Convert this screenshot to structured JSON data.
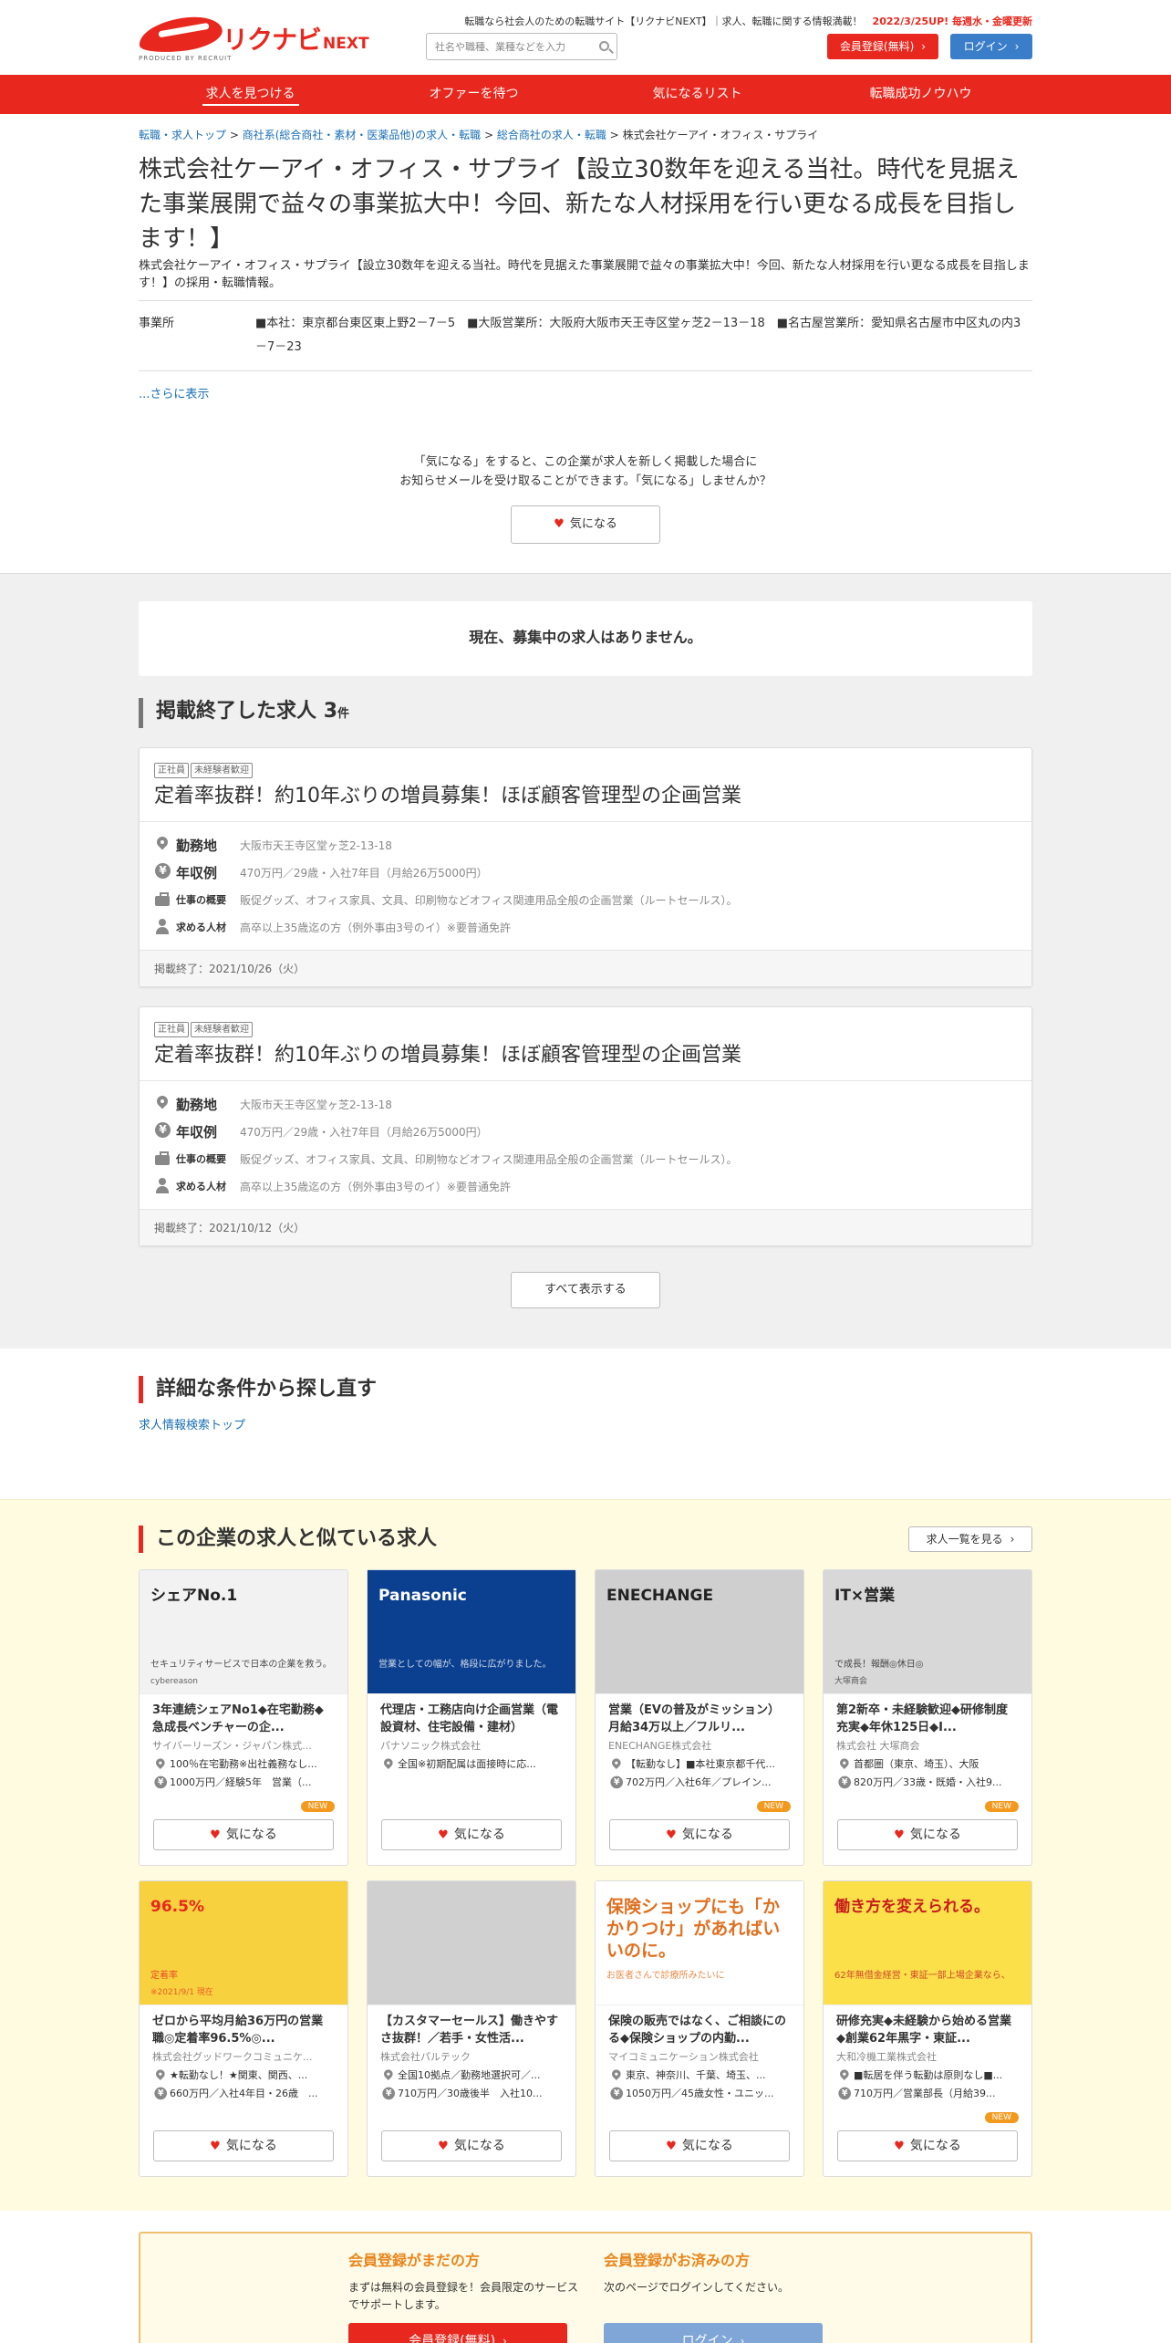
{
  "header": {
    "tagline_prefix": "転職なら社会人のための転職サイト【リクナビNEXT】｜求人、転職に関する情報満載！",
    "tagline_update": "2022/3/25UP! 毎週水・金曜更新",
    "brand_logo": "リクナビ",
    "brand_logo_sub": "NEXT",
    "produced_by": "PRODUCED BY RECRUIT",
    "search_placeholder": "社名や職種、業種などを入力",
    "register_label": "会員登録(無料)",
    "login_label": "ログイン",
    "accent_color": "#e8281e",
    "login_color": "#3a7dc9"
  },
  "nav": {
    "items": [
      {
        "label": "求人を見つける"
      },
      {
        "label": "オファーを待つ"
      },
      {
        "label": "気になるリスト"
      },
      {
        "label": "転職成功ノウハウ"
      }
    ]
  },
  "breadcrumb": {
    "items": [
      "転職・求人トップ",
      "商社系(総合商社・素材・医薬品他)の求人・転職",
      "総合商社の求人・転職"
    ],
    "current": "株式会社ケーアイ・オフィス・サプライ",
    "sep": ">"
  },
  "company": {
    "title": "株式会社ケーアイ・オフィス・サプライ【設立30数年を迎える当社。時代を見据えた事業展開で益々の事業拡大中！今回、新たな人材採用を行い更なる成長を目指します！】",
    "subtitle": "株式会社ケーアイ・オフィス・サプライ【設立30数年を迎える当社。時代を見据えた事業展開で益々の事業拡大中！今回、新たな人材採用を行い更なる成長を目指します！】の採用・転職情報。",
    "office_label": "事業所",
    "office_value": "■本社：東京都台東区東上野2－7－5　■大阪営業所：大阪府大阪市天王寺区堂ヶ芝2－13－18　■名古屋営業所：愛知県名古屋市中区丸の内3－7－23",
    "more_link": "...さらに表示",
    "kininaru_text_1": "「気になる」をすると、この企業が求人を新しく掲載した場合に",
    "kininaru_text_2": "お知らせメールを受け取ることができます。「気になる」しませんか？",
    "kininaru_button": "気になる"
  },
  "jobs": {
    "none_message": "現在、募集中の求人はありません。",
    "ended_heading": "掲載終了した求人",
    "ended_count": "3",
    "ended_unit": "件",
    "show_all": "すべて表示する",
    "items": [
      {
        "tags": [
          "正社員",
          "未経験者歓迎"
        ],
        "title": "定着率抜群！約10年ぶりの増員募集！ほぼ顧客管理型の企画営業",
        "location_label": "勤務地",
        "location": "大阪市天王寺区堂ヶ芝2-13-18",
        "salary_label": "年収例",
        "salary": "470万円／29歳・入社7年目（月給26万5000円）",
        "work_label": "仕事の概要",
        "work": "販促グッズ、オフィス家具、文具、印刷物などオフィス関連用品全般の企画営業（ルートセールス）。",
        "person_label": "求める人材",
        "person": "高卒以上35歳迄の方（例外事由3号のイ）※要普通免許",
        "end": "掲載終了：2021/10/26（火）"
      },
      {
        "tags": [
          "正社員",
          "未経験者歓迎"
        ],
        "title": "定着率抜群！約10年ぶりの増員募集！ほぼ顧客管理型の企画営業",
        "location_label": "勤務地",
        "location": "大阪市天王寺区堂ヶ芝2-13-18",
        "salary_label": "年収例",
        "salary": "470万円／29歳・入社7年目（月給26万5000円）",
        "work_label": "仕事の概要",
        "work": "販促グッズ、オフィス家具、文具、印刷物などオフィス関連用品全般の企画営業（ルートセールス）。",
        "person_label": "求める人材",
        "person": "高卒以上35歳迄の方（例外事由3号のイ）※要普通免許",
        "end": "掲載終了：2021/10/12（火）"
      }
    ]
  },
  "detail_search": {
    "heading": "詳細な条件から探し直す",
    "link": "求人情報検索トップ"
  },
  "similar": {
    "heading": "この企業の求人と似ている求人",
    "list_button": "求人一覧を見る",
    "kininaru": "気になる",
    "new_label": "NEW",
    "cards": [
      {
        "title": "3年連続シェアNo1◆在宅勤務◆急成長ベンチャーの企...",
        "company": "サイバーリーズン・ジャパン株式...",
        "loc": "100％在宅勤務※出社義務なし...",
        "sal": "1000万円／経験5年　営業（...",
        "new": true,
        "thumb_text": "シェアNo.1",
        "thumb_sub": "セキュリティサービスで日本の企業を救う。",
        "thumb_sub2": "cybereason",
        "thumb_bg": "#f2f2f2",
        "thumb_fg": "#222"
      },
      {
        "title": "代理店・工務店向け企画営業（電設資材、住宅設備・建材）",
        "company": "パナソニック株式会社",
        "loc": "全国※初期配属は面接時に応...",
        "sal": "",
        "new": false,
        "thumb_text": "Panasonic",
        "thumb_sub": "営業としての幅が、格段に広がりました。",
        "thumb_sub2": "",
        "thumb_bg": "#0b3f8f",
        "thumb_fg": "#fff"
      },
      {
        "title": "営業（EVの普及がミッション）月給34万以上／フルリ...",
        "company": "ENECHANGE株式会社",
        "loc": "【転勤なし】■本社東京都千代...",
        "sal": "702万円／入社6年／プレイン...",
        "new": true,
        "thumb_text": "ENECHANGE",
        "thumb_sub": "",
        "thumb_sub2": "",
        "thumb_bg": "#cfcfcf",
        "thumb_fg": "#222"
      },
      {
        "title": "第2新卒・未経験歓迎◆研修制度充実◆年休125日◆I...",
        "company": "株式会社 大塚商会",
        "loc": "首都圏（東京、埼玉）、大阪",
        "sal": "820万円／33歳・既婚・入社9...",
        "new": true,
        "thumb_text": "IT×営業",
        "thumb_sub": "で成長！報酬◎休日◎",
        "thumb_sub2": "大塚商会",
        "thumb_bg": "#d8d8d8",
        "thumb_fg": "#222"
      },
      {
        "title": "ゼロから平均月給36万円の営業職◎定着率96.5%◎...",
        "company": "株式会社グッドワークコミュニケ...",
        "loc": "★転勤なし！★関東、関西、...",
        "sal": "660万円／入社4年目・26歳　...",
        "new": false,
        "thumb_text": "96.5%",
        "thumb_sub": "定着率",
        "thumb_sub2": "※2021/9/1 現在",
        "thumb_bg": "#f7d23e",
        "thumb_fg": "#e8281e"
      },
      {
        "title": "【カスタマーセールス】働きやすさ抜群！／若手・女性活...",
        "company": "株式会社パルテック",
        "loc": "全国10拠点／勤務地選択可／...",
        "sal": "710万円／30歳後半　入社10...",
        "new": false,
        "thumb_text": "",
        "thumb_sub": "",
        "thumb_sub2": "",
        "thumb_bg": "#d0d0d0",
        "thumb_fg": "#222"
      },
      {
        "title": "保険の販売ではなく、ご相談にのる◆保険ショップの内勤...",
        "company": "マイコミュニケーション株式会社",
        "loc": "東京、神奈川、千葉、埼玉、...",
        "sal": "1050万円／45歳女性・ユニッ...",
        "new": false,
        "thumb_text": "保険ショップにも「かかりつけ」があればいいのに。",
        "thumb_sub": "お医者さんで診療所みたいに",
        "thumb_sub2": "",
        "thumb_bg": "#fff",
        "thumb_fg": "#e07020"
      },
      {
        "title": "研修充実◆未経験から始める営業◆創業62年黒字・東証...",
        "company": "大和冷機工業株式会社",
        "loc": "■転居を伴う転勤は原則なし■...",
        "sal": "710万円／営業部長（月給39...",
        "new": true,
        "thumb_text": "働き方を変えられる。",
        "thumb_sub": "62年無借金経営・東証一部上場企業なら、",
        "thumb_sub2": "",
        "thumb_bg": "#fbe04a",
        "thumb_fg": "#c81e1e"
      }
    ]
  },
  "register": {
    "left_heading": "会員登録がまだの方",
    "left_text": "まずは無料の会員登録を！会員限定のサービスでサポートします。",
    "left_button": "会員登録(無料)",
    "right_heading": "会員登録がお済みの方",
    "right_text": "次のページでログインしてください。",
    "right_button": "ログイン"
  }
}
